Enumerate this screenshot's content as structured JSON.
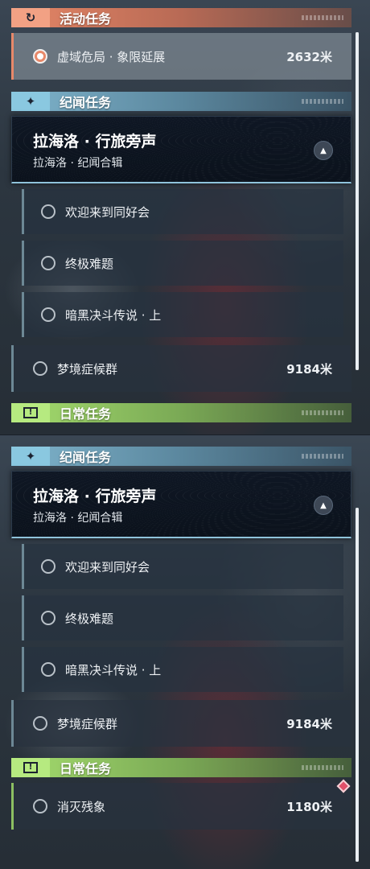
{
  "categories": {
    "event": {
      "title": "活动任务",
      "icon": "event-icon"
    },
    "story": {
      "title": "纪闻任务",
      "icon": "sparkle-icon"
    },
    "daily": {
      "title": "日常任务",
      "icon": "exclamation-icon"
    }
  },
  "event_quest": {
    "name": "虚域危局 · 象限延展",
    "distance": "2632米",
    "selected": true
  },
  "story_chapter": {
    "title": "拉海洛 · 行旅旁声",
    "subtitle": "拉海洛 · 纪闻合辑",
    "sub_quests": [
      {
        "name": "欢迎来到同好会"
      },
      {
        "name": "终极难题"
      },
      {
        "name": "暗黑决斗传说 · 上"
      }
    ]
  },
  "dream_quest": {
    "name": "梦境症候群",
    "distance": "9184米"
  },
  "daily_quest": {
    "name": "消灭残象",
    "distance": "1180米"
  },
  "colors": {
    "event_accent": "#e8896a",
    "story_accent": "#8ac8e0",
    "daily_accent": "#b6ea80",
    "tracked_marker": "#e0506a"
  }
}
